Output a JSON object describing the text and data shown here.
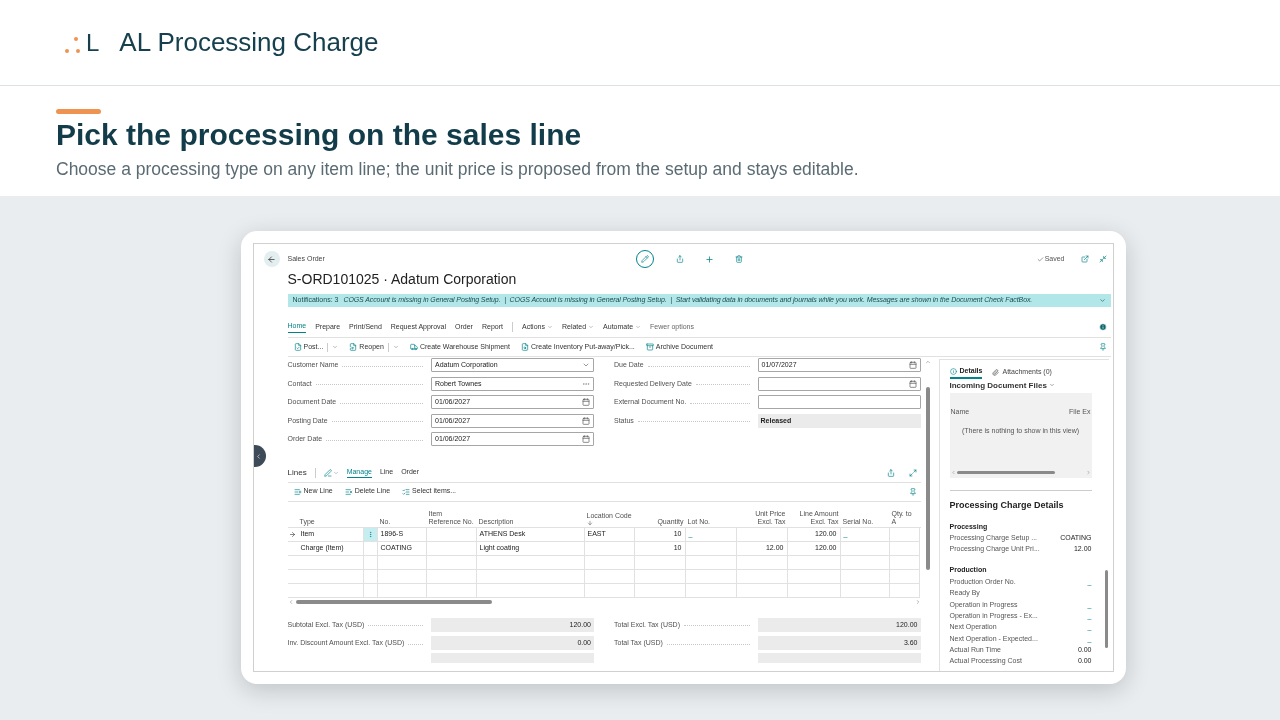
{
  "header": {
    "logo_text": "L",
    "title": "AL Processing Charge"
  },
  "section": {
    "heading": "Pick the processing on the sales line",
    "description": "Choose a processing type on any item line; the unit price is proposed from the setup and stays editable."
  },
  "app": {
    "page_type": "Sales Order",
    "title": "S-ORD101025 · Adatum Corporation",
    "save_status": "Saved",
    "notification": {
      "count_label": "Notifications: 3",
      "message": "COGS Account is missing in General Posting Setup.  |  COGS Account is missing in General Posting Setup.  |  Start validating data in documents and journals while you work. Messages are shown in the Document Check FactBox."
    },
    "action_tabs": [
      {
        "label": "Home",
        "selected": true
      },
      {
        "label": "Prepare",
        "selected": false
      },
      {
        "label": "Print/Send",
        "selected": false
      },
      {
        "label": "Request Approval",
        "selected": false
      },
      {
        "label": "Order",
        "selected": false
      },
      {
        "label": "Report",
        "selected": false
      }
    ],
    "action_menus": [
      "Actions",
      "Related",
      "Automate"
    ],
    "fewer_options": "Fewer options",
    "actions": [
      {
        "label": "Post...",
        "split": true
      },
      {
        "label": "Reopen",
        "split": true
      },
      {
        "label": "Create Warehouse Shipment",
        "split": false
      },
      {
        "label": "Create Inventory Put-away/Pick...",
        "split": false
      },
      {
        "label": "Archive Document",
        "split": false
      }
    ],
    "fields": [
      {
        "label": "Customer Name",
        "value": "Adatum Corporation",
        "kind": "dropdown"
      },
      {
        "label": "Due Date",
        "value": "01/07/2027",
        "kind": "date"
      },
      {
        "label": "Contact",
        "value": "Robert Townes",
        "kind": "lookup"
      },
      {
        "label": "Requested Delivery Date",
        "kind": "date"
      },
      {
        "label": "Document Date",
        "value": "01/06/2027",
        "kind": "date"
      },
      {
        "label": "External Document No.",
        "kind": "text"
      },
      {
        "label": "Posting Date",
        "value": "01/06/2027",
        "kind": "date"
      },
      {
        "label": "Status",
        "value": "Released",
        "kind": "readonly"
      },
      {
        "label": "Order Date",
        "value": "01/06/2027",
        "kind": "date"
      }
    ],
    "lines": {
      "title": "Lines",
      "tabs": [
        {
          "label": "Manage",
          "selected": true
        },
        {
          "label": "Line",
          "selected": false
        },
        {
          "label": "Order",
          "selected": false
        }
      ],
      "actions": [
        "New Line",
        "Delete Line",
        "Select items..."
      ],
      "columns": [
        {
          "label": "Type",
          "kind": "text"
        },
        {
          "label": "No.",
          "kind": "text"
        },
        {
          "label": "Item Reference No.",
          "kind": "text"
        },
        {
          "label": "Description",
          "kind": "text"
        },
        {
          "label": "Location Code",
          "kind": "text",
          "sorted": true
        },
        {
          "label": "Quantity",
          "kind": "number"
        },
        {
          "label": "Lot No.",
          "kind": "text"
        },
        {
          "label": "Unit Price Excl. Tax",
          "kind": "number"
        },
        {
          "label": "Line Amount Excl. Tax",
          "kind": "number"
        },
        {
          "label": "Serial No.",
          "kind": "text"
        },
        {
          "label": "Qty. to A",
          "kind": "text"
        }
      ],
      "rows": [
        {
          "selected": true,
          "cells": [
            "Item",
            "1896-S",
            null,
            "ATHENS Desk",
            "EAST",
            "10",
            {
              "text": "_",
              "kind": "link"
            },
            null,
            "120.00",
            {
              "text": "_",
              "kind": "link"
            },
            null
          ]
        },
        {
          "selected": false,
          "cells": [
            "Charge (Item)",
            "COATING",
            null,
            "Light coating",
            null,
            "10",
            null,
            "12.00",
            "120.00",
            null,
            null
          ]
        }
      ]
    },
    "totals": [
      {
        "label": "Subtotal Excl. Tax (USD)",
        "value": "120.00"
      },
      {
        "label": "Total Excl. Tax (USD)",
        "value": "120.00"
      },
      {
        "label": "Inv. Discount Amount Excl. Tax (USD)",
        "value": "0.00"
      },
      {
        "label": "Total Tax (USD)",
        "value": "3.60"
      }
    ],
    "factbox": {
      "tabs": [
        {
          "label": "Details",
          "selected": true
        },
        {
          "label": "Attachments (0)",
          "selected": false
        }
      ],
      "incoming_title": "Incoming Document Files",
      "incoming_columns": [
        "Name",
        "File Ex"
      ],
      "empty_text": "(There is nothing to show in this view)",
      "details_title": "Processing Charge Details",
      "groups": [
        {
          "title": "Processing",
          "rows": [
            {
              "label": "Processing Charge Setup ...",
              "value": "COATING",
              "link": false
            },
            {
              "label": "Processing Charge Unit Pri...",
              "value": "12.00",
              "link": false
            }
          ]
        },
        {
          "title": "Production",
          "rows": [
            {
              "label": "Production Order No.",
              "value": "_",
              "link": true
            },
            {
              "label": "Ready By"
            },
            {
              "label": "Operation in Progress",
              "value": "_",
              "link": true
            },
            {
              "label": "Operation in Progress - Ex...",
              "value": "_",
              "link": true
            },
            {
              "label": "Next Operation",
              "value": "_",
              "link": true
            },
            {
              "label": "Next Operation - Expected...",
              "value": "_",
              "link": true
            },
            {
              "label": "Actual Run Time",
              "value": "0.00",
              "link": false
            },
            {
              "label": "Actual Processing Cost",
              "value": "0.00",
              "link": false
            }
          ]
        }
      ]
    }
  }
}
